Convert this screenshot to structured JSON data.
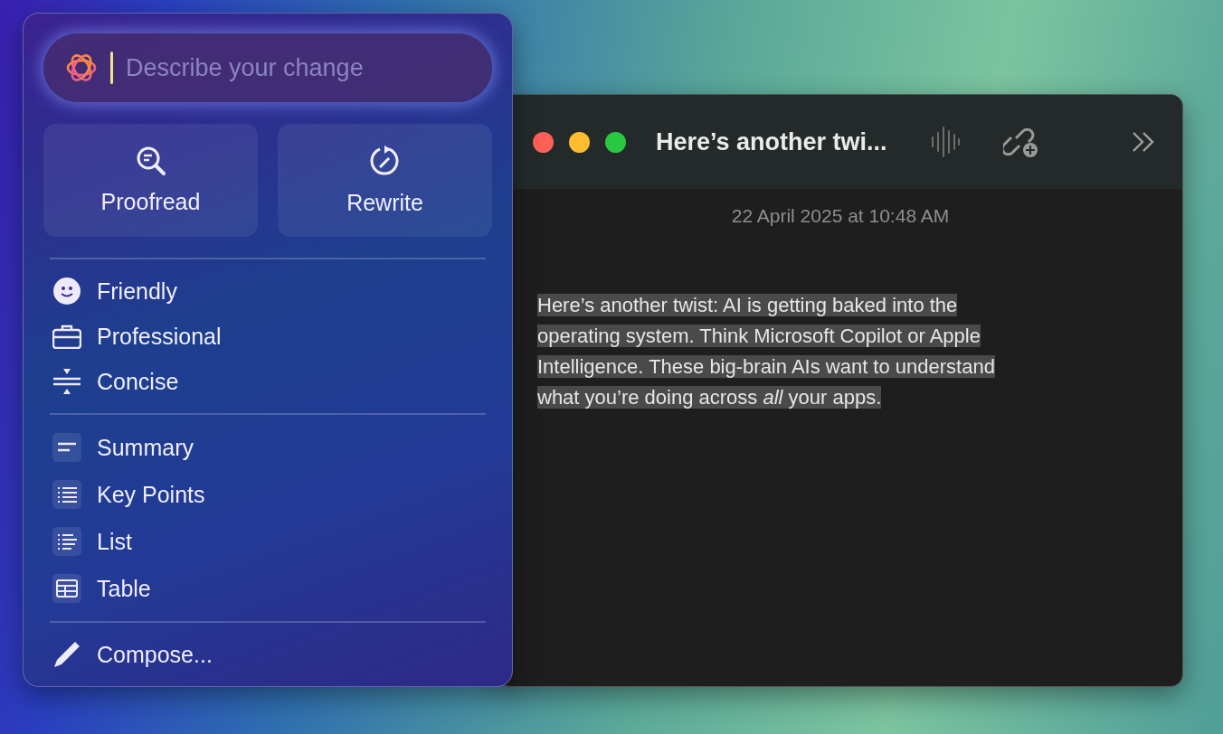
{
  "writing_tools": {
    "prompt_field": {
      "placeholder": "Describe your change"
    },
    "actions": [
      {
        "label": "Proofread"
      },
      {
        "label": "Rewrite"
      }
    ],
    "groups": [
      {
        "items": [
          {
            "label": "Friendly",
            "kind": "plain"
          },
          {
            "label": "Professional",
            "kind": "plain"
          },
          {
            "label": "Concise",
            "kind": "plain"
          }
        ]
      },
      {
        "items": [
          {
            "label": "Summary",
            "kind": "tile"
          },
          {
            "label": "Key Points",
            "kind": "tile"
          },
          {
            "label": "List",
            "kind": "tile"
          },
          {
            "label": "Table",
            "kind": "tile"
          }
        ]
      },
      {
        "items": [
          {
            "label": "Compose...",
            "kind": "plain"
          }
        ]
      }
    ]
  },
  "note_window": {
    "title": "Here’s another twi...",
    "date": "22 April 2025 at 10:48 AM",
    "body": "Here’s another twist: AI is getting baked into the operating system. Think Microsoft Copilot or Apple Intelligence. These big-brain AIs want to understand what you’re doing across *all* your apps.",
    "body_selected": true
  }
}
